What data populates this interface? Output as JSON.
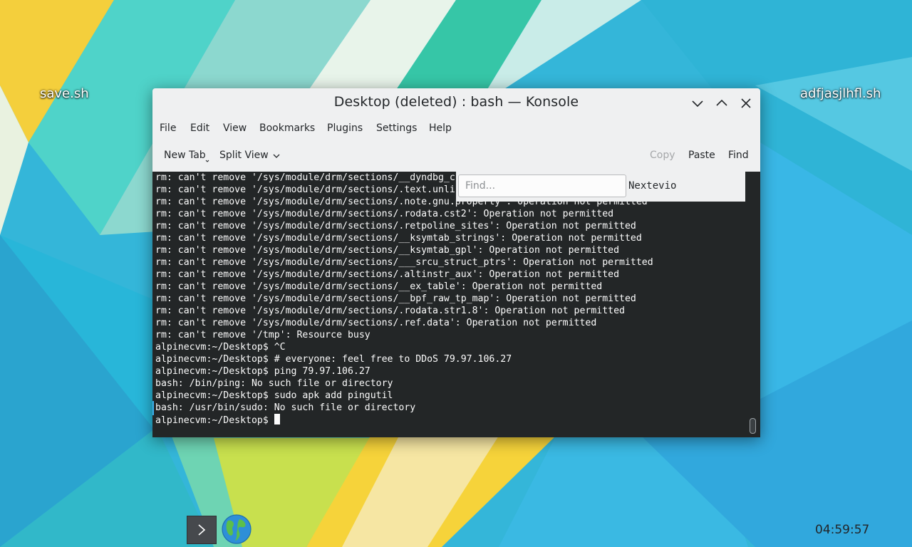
{
  "desktop": {
    "icons": [
      {
        "label": "save.sh"
      },
      {
        "label": "adfjasjlhfl.sh"
      }
    ],
    "clock": "04:59:57"
  },
  "window": {
    "title": "Desktop (deleted) : bash — Konsole",
    "menu": [
      "File",
      "Edit",
      "View",
      "Bookmarks",
      "Plugins",
      "Settings",
      "Help"
    ],
    "toolbar": {
      "new_tab": "New Tab",
      "split_view": "Split View",
      "copy": "Copy",
      "paste": "Paste",
      "find": "Find"
    },
    "find_bar": {
      "placeholder": "Find...",
      "next_label": "Nextevio"
    },
    "terminal": {
      "lines": [
        "rm: can't remove '/sys/module/drm/sections/__dyndbg_c",
        "rm: can't remove '/sys/module/drm/sections/.text.unli",
        "rm: can't remove '/sys/module/drm/sections/.note.gnu.property': Operation not permitted",
        "rm: can't remove '/sys/module/drm/sections/.rodata.cst2': Operation not permitted",
        "rm: can't remove '/sys/module/drm/sections/.retpoline_sites': Operation not permitted",
        "rm: can't remove '/sys/module/drm/sections/__ksymtab_strings': Operation not permitted",
        "rm: can't remove '/sys/module/drm/sections/__ksymtab_gpl': Operation not permitted",
        "rm: can't remove '/sys/module/drm/sections/___srcu_struct_ptrs': Operation not permitted",
        "rm: can't remove '/sys/module/drm/sections/.altinstr_aux': Operation not permitted",
        "rm: can't remove '/sys/module/drm/sections/__ex_table': Operation not permitted",
        "rm: can't remove '/sys/module/drm/sections/__bpf_raw_tp_map': Operation not permitted",
        "rm: can't remove '/sys/module/drm/sections/.rodata.str1.8': Operation not permitted",
        "rm: can't remove '/sys/module/drm/sections/.ref.data': Operation not permitted",
        "rm: can't remove '/tmp': Resource busy",
        "alpinecvm:~/Desktop$ ^C",
        "alpinecvm:~/Desktop$ # everyone: feel free to DDoS 79.97.106.27",
        "alpinecvm:~/Desktop$ ping 79.97.106.27",
        "bash: /bin/ping: No such file or directory",
        "alpinecvm:~/Desktop$ sudo apk add pingutil",
        "bash: /usr/bin/sudo: No such file or directory"
      ],
      "prompt": "alpinecvm:~/Desktop$ "
    }
  }
}
